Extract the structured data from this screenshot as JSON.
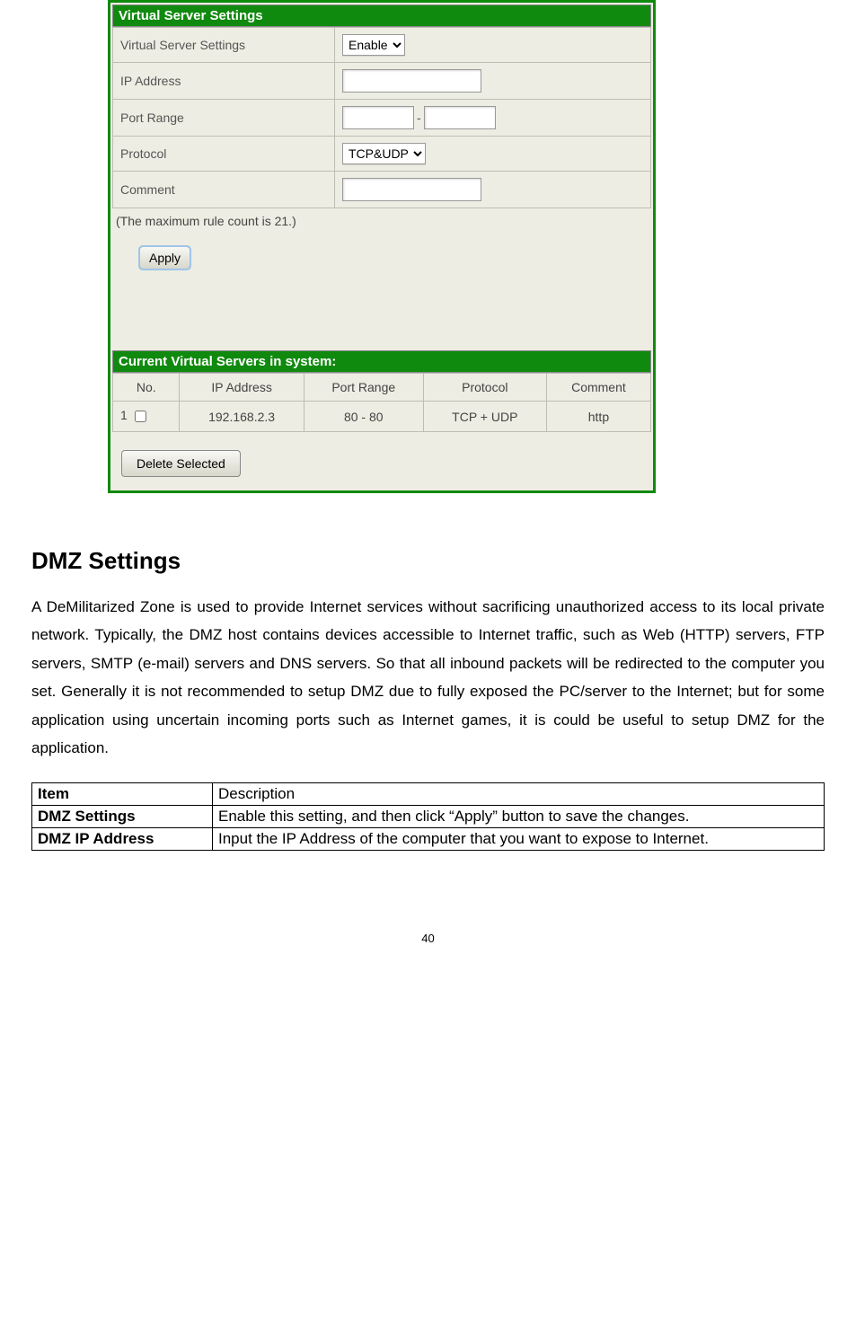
{
  "panel1": {
    "title": "Virtual Server Settings",
    "rows": {
      "vss_label": "Virtual Server Settings",
      "vss_value": "Enable",
      "ip_label": "IP Address",
      "port_label": "Port Range",
      "port_sep": "-",
      "proto_label": "Protocol",
      "proto_value": "TCP&UDP",
      "comment_label": "Comment"
    },
    "note": "(The maximum rule count is 21.)",
    "apply_label": "Apply"
  },
  "panel2": {
    "title": "Current Virtual Servers in system:",
    "headers": [
      "No.",
      "IP Address",
      "Port Range",
      "Protocol",
      "Comment"
    ],
    "row": {
      "no": "1",
      "ip": "192.168.2.3",
      "port": "80 - 80",
      "proto": "TCP + UDP",
      "comment": "http"
    },
    "delete_label": "Delete Selected"
  },
  "doc": {
    "heading": "DMZ Settings",
    "paragraph": "A DeMilitarized Zone is used to provide Internet services without sacrificing unauthorized access to its local private network. Typically, the DMZ host contains devices accessible to Internet traffic, such as Web (HTTP) servers, FTP servers, SMTP (e-mail) servers and DNS servers. So that all inbound packets will be redirected to the computer you set. Generally it is not recommended to setup DMZ due to fully exposed the PC/server to the Internet; but for some application using uncertain incoming ports such as Internet games, it is could be useful to setup DMZ for the application.",
    "table": {
      "header_item": "Item",
      "header_desc": "Description",
      "rows": [
        {
          "item": "DMZ Settings",
          "desc": "Enable this setting, and then click “Apply” button to save the changes."
        },
        {
          "item": "DMZ IP Address",
          "desc": "Input the IP Address of the computer that you want to expose to Internet."
        }
      ]
    }
  },
  "page_number": "40",
  "chart_data": {
    "type": "table",
    "title": "Current Virtual Servers in system",
    "columns": [
      "No.",
      "IP Address",
      "Port Range",
      "Protocol",
      "Comment"
    ],
    "rows": [
      [
        "1",
        "192.168.2.3",
        "80 - 80",
        "TCP + UDP",
        "http"
      ]
    ]
  }
}
